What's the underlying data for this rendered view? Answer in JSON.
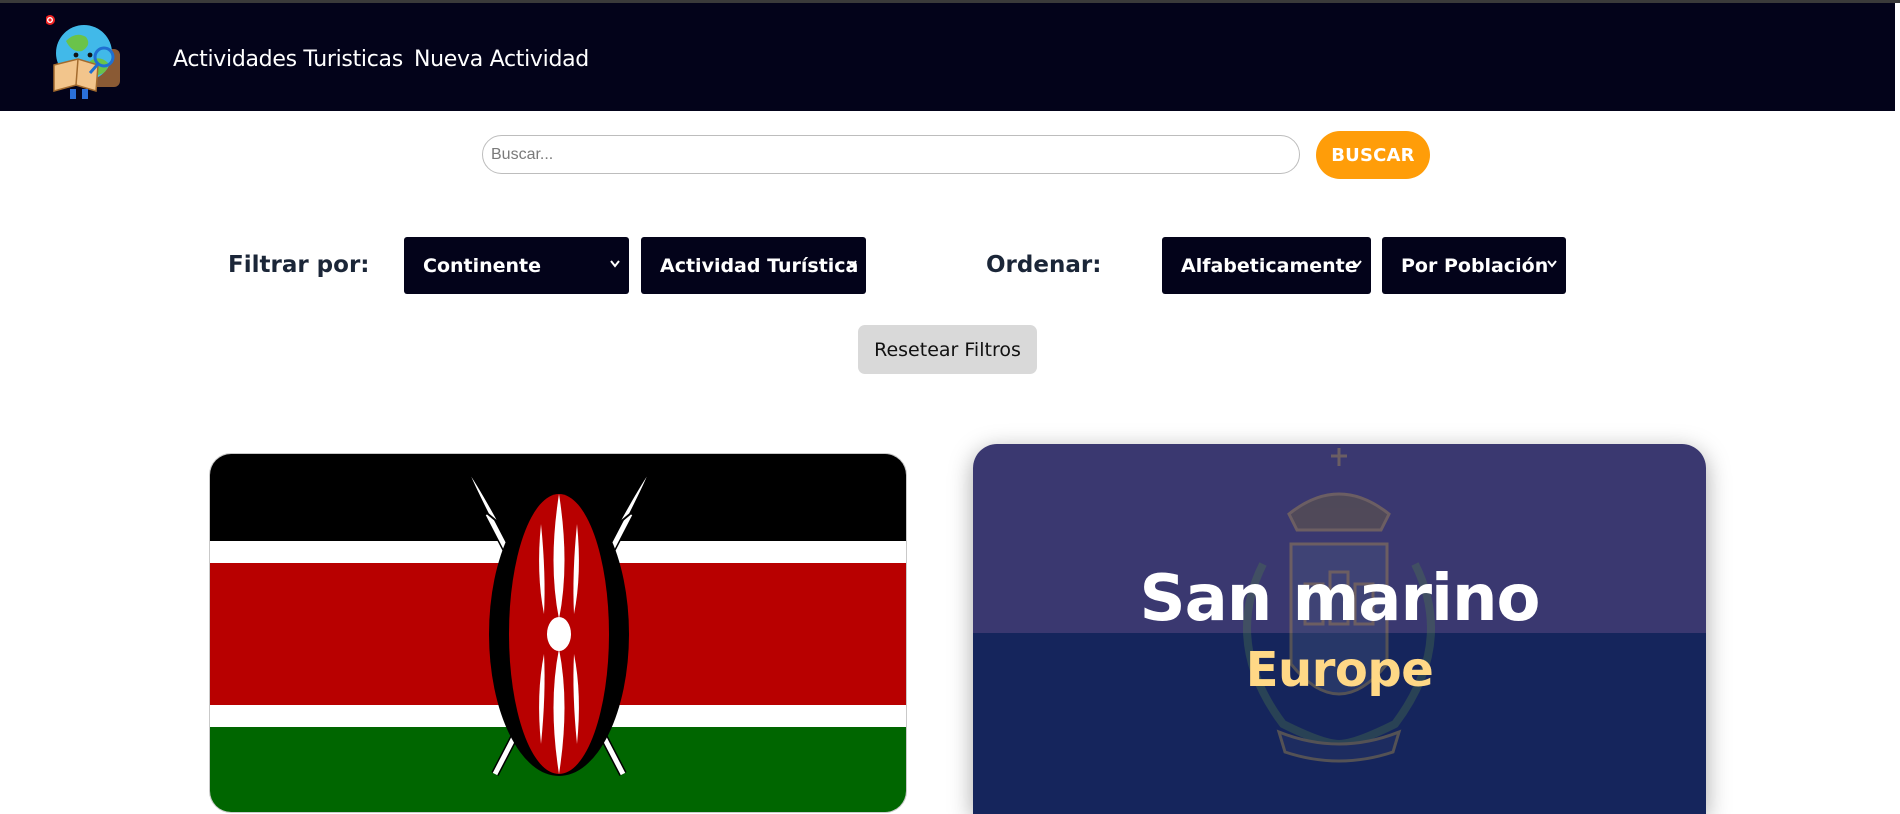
{
  "nav": {
    "link_activities": "Actividades Turisticas",
    "link_new_activity": "Nueva Actividad"
  },
  "search": {
    "placeholder": "Buscar...",
    "button_label": "BUSCAR"
  },
  "filters": {
    "filter_label": "Filtrar por:",
    "continent_select": "Continente",
    "activity_select": "Actividad Turística",
    "order_label": "Ordenar:",
    "alpha_select": "Alfabeticamente",
    "population_select": "Por Población",
    "reset_label": "Resetear Filtros"
  },
  "cards": [
    {
      "flag": "kenya-flag"
    },
    {
      "name": "San marino",
      "continent": "Europe",
      "flag": "san-marino-flag"
    }
  ],
  "colors": {
    "navbar": "#03031a",
    "accent": "#ff9d09",
    "continent_text": "#ffd886"
  }
}
